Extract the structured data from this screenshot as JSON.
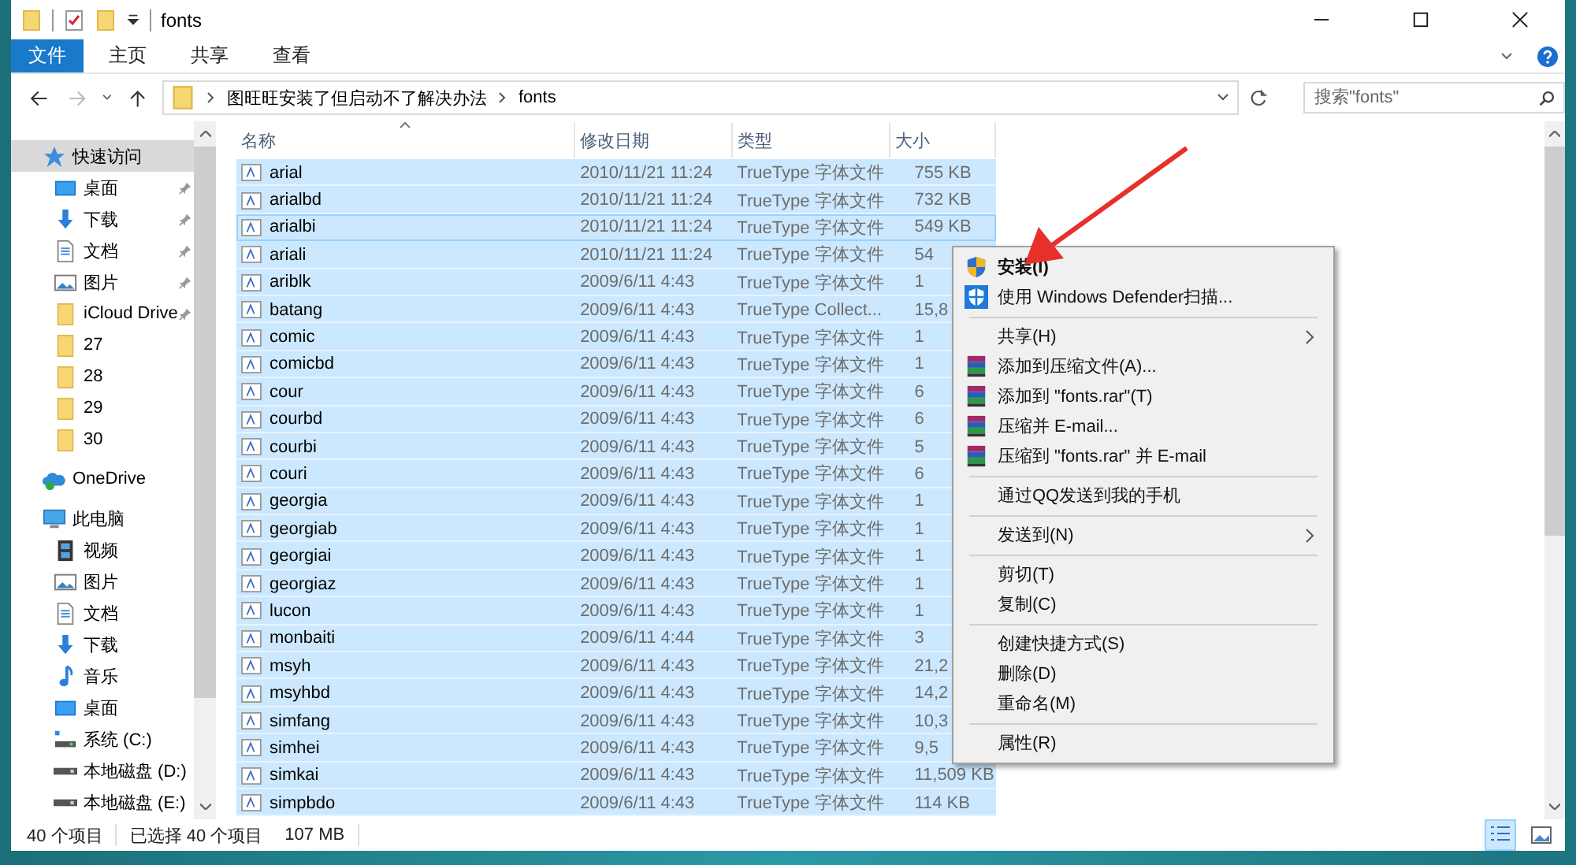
{
  "window": {
    "title": "fonts"
  },
  "ribbon": {
    "tabs": [
      {
        "label": "文件",
        "selected": true
      },
      {
        "label": "主页",
        "selected": false
      },
      {
        "label": "共享",
        "selected": false
      },
      {
        "label": "查看",
        "selected": false
      }
    ]
  },
  "address_bar": {
    "path": [
      "图旺旺安装了但启动不了解决办法",
      "fonts"
    ],
    "search": {
      "placeholder": "搜索\"fonts\""
    }
  },
  "sidebar": {
    "items": [
      {
        "label": "快速访问",
        "kind": "star",
        "selected": true,
        "children": [
          {
            "label": "桌面",
            "kind": "desktop",
            "pinned": true,
            "selected": false
          },
          {
            "label": "下载",
            "kind": "download",
            "pinned": true,
            "selected": false
          },
          {
            "label": "文档",
            "kind": "document",
            "pinned": true,
            "selected": false
          },
          {
            "label": "图片",
            "kind": "picture",
            "pinned": true,
            "selected": false
          },
          {
            "label": "iCloud Drive",
            "kind": "folder",
            "pinned": true,
            "selected": false
          },
          {
            "label": "27",
            "kind": "folder",
            "pinned": false,
            "selected": false
          },
          {
            "label": "28",
            "kind": "folder",
            "pinned": false,
            "selected": false
          },
          {
            "label": "29",
            "kind": "folder",
            "pinned": false,
            "selected": false
          },
          {
            "label": "30",
            "kind": "folder",
            "pinned": false,
            "selected": false
          }
        ]
      },
      {
        "label": "OneDrive",
        "kind": "cloud",
        "selected": false
      },
      {
        "label": "此电脑",
        "kind": "computer",
        "selected": false,
        "children": [
          {
            "label": "视频",
            "kind": "video",
            "pinned": false,
            "selected": false
          },
          {
            "label": "图片",
            "kind": "picture",
            "pinned": false,
            "selected": false
          },
          {
            "label": "文档",
            "kind": "document",
            "pinned": false,
            "selected": false
          },
          {
            "label": "下载",
            "kind": "download",
            "pinned": false,
            "selected": false
          },
          {
            "label": "音乐",
            "kind": "music",
            "pinned": false,
            "selected": false
          },
          {
            "label": "桌面",
            "kind": "desktop",
            "pinned": false,
            "selected": false
          },
          {
            "label": "系统 (C:)",
            "kind": "system-drive",
            "pinned": false,
            "selected": false
          },
          {
            "label": "本地磁盘 (D:)",
            "kind": "drive",
            "pinned": false,
            "selected": false
          },
          {
            "label": "本地磁盘 (E:)",
            "kind": "drive",
            "pinned": false,
            "selected": false
          }
        ]
      }
    ]
  },
  "table": {
    "columns": [
      "名称",
      "修改日期",
      "类型",
      "大小"
    ],
    "rows": [
      {
        "name": "arial",
        "date": "2010/11/21 11:24",
        "type": "TrueType 字体文件",
        "size": "755 KB",
        "selected": true,
        "focused": false
      },
      {
        "name": "arialbd",
        "date": "2010/11/21 11:24",
        "type": "TrueType 字体文件",
        "size": "732 KB",
        "selected": true,
        "focused": false
      },
      {
        "name": "arialbi",
        "date": "2010/11/21 11:24",
        "type": "TrueType 字体文件",
        "size": "549 KB",
        "selected": true,
        "focused": true
      },
      {
        "name": "ariali",
        "date": "2010/11/21 11:24",
        "type": "TrueType 字体文件",
        "size": "54",
        "selected": true,
        "focused": false
      },
      {
        "name": "ariblk",
        "date": "2009/6/11 4:43",
        "type": "TrueType 字体文件",
        "size": "1",
        "selected": true,
        "focused": false
      },
      {
        "name": "batang",
        "date": "2009/6/11 4:43",
        "type": "TrueType Collect...",
        "size": "15,8",
        "selected": true,
        "focused": false
      },
      {
        "name": "comic",
        "date": "2009/6/11 4:43",
        "type": "TrueType 字体文件",
        "size": "1",
        "selected": true,
        "focused": false
      },
      {
        "name": "comicbd",
        "date": "2009/6/11 4:43",
        "type": "TrueType 字体文件",
        "size": "1",
        "selected": true,
        "focused": false
      },
      {
        "name": "cour",
        "date": "2009/6/11 4:43",
        "type": "TrueType 字体文件",
        "size": "6",
        "selected": true,
        "focused": false
      },
      {
        "name": "courbd",
        "date": "2009/6/11 4:43",
        "type": "TrueType 字体文件",
        "size": "6",
        "selected": true,
        "focused": false
      },
      {
        "name": "courbi",
        "date": "2009/6/11 4:43",
        "type": "TrueType 字体文件",
        "size": "5",
        "selected": true,
        "focused": false
      },
      {
        "name": "couri",
        "date": "2009/6/11 4:43",
        "type": "TrueType 字体文件",
        "size": "6",
        "selected": true,
        "focused": false
      },
      {
        "name": "georgia",
        "date": "2009/6/11 4:43",
        "type": "TrueType 字体文件",
        "size": "1",
        "selected": true,
        "focused": false
      },
      {
        "name": "georgiab",
        "date": "2009/6/11 4:43",
        "type": "TrueType 字体文件",
        "size": "1",
        "selected": true,
        "focused": false
      },
      {
        "name": "georgiai",
        "date": "2009/6/11 4:43",
        "type": "TrueType 字体文件",
        "size": "1",
        "selected": true,
        "focused": false
      },
      {
        "name": "georgiaz",
        "date": "2009/6/11 4:43",
        "type": "TrueType 字体文件",
        "size": "1",
        "selected": true,
        "focused": false
      },
      {
        "name": "lucon",
        "date": "2009/6/11 4:43",
        "type": "TrueType 字体文件",
        "size": "1",
        "selected": true,
        "focused": false
      },
      {
        "name": "monbaiti",
        "date": "2009/6/11 4:44",
        "type": "TrueType 字体文件",
        "size": "3",
        "selected": true,
        "focused": false
      },
      {
        "name": "msyh",
        "date": "2009/6/11 4:43",
        "type": "TrueType 字体文件",
        "size": "21,2",
        "selected": true,
        "focused": false
      },
      {
        "name": "msyhbd",
        "date": "2009/6/11 4:43",
        "type": "TrueType 字体文件",
        "size": "14,2",
        "selected": true,
        "focused": false
      },
      {
        "name": "simfang",
        "date": "2009/6/11 4:43",
        "type": "TrueType 字体文件",
        "size": "10,3",
        "selected": true,
        "focused": false
      },
      {
        "name": "simhei",
        "date": "2009/6/11 4:43",
        "type": "TrueType 字体文件",
        "size": "9,5",
        "selected": true,
        "focused": false
      },
      {
        "name": "simkai",
        "date": "2009/6/11 4:43",
        "type": "TrueType 字体文件",
        "size": "11,509 KB",
        "selected": true,
        "focused": false
      },
      {
        "name": "simpbdo",
        "date": "2009/6/11 4:43",
        "type": "TrueType 字体文件",
        "size": "114 KB",
        "selected": true,
        "focused": false
      }
    ]
  },
  "context_menu": {
    "groups": [
      [
        {
          "label": "安装(I)",
          "kind": "shield",
          "default": true,
          "submenu": false
        },
        {
          "label": "使用 Windows Defender扫描...",
          "kind": "defender",
          "default": false,
          "submenu": false
        }
      ],
      [
        {
          "label": "共享(H)",
          "kind": "none",
          "default": false,
          "submenu": true
        },
        {
          "label": "添加到压缩文件(A)...",
          "kind": "archive",
          "default": false,
          "submenu": false
        },
        {
          "label": "添加到 \"fonts.rar\"(T)",
          "kind": "archive",
          "default": false,
          "submenu": false
        },
        {
          "label": "压缩并 E-mail...",
          "kind": "archive",
          "default": false,
          "submenu": false
        },
        {
          "label": "压缩到 \"fonts.rar\" 并 E-mail",
          "kind": "archive",
          "default": false,
          "submenu": false
        }
      ],
      [
        {
          "label": "通过QQ发送到我的手机",
          "kind": "none",
          "default": false,
          "submenu": false
        }
      ],
      [
        {
          "label": "发送到(N)",
          "kind": "none",
          "default": false,
          "submenu": true
        }
      ],
      [
        {
          "label": "剪切(T)",
          "kind": "none",
          "default": false,
          "submenu": false
        },
        {
          "label": "复制(C)",
          "kind": "none",
          "default": false,
          "submenu": false
        }
      ],
      [
        {
          "label": "创建快捷方式(S)",
          "kind": "none",
          "default": false,
          "submenu": false
        },
        {
          "label": "删除(D)",
          "kind": "none",
          "default": false,
          "submenu": false
        },
        {
          "label": "重命名(M)",
          "kind": "none",
          "default": false,
          "submenu": false
        }
      ],
      [
        {
          "label": "属性(R)",
          "kind": "none",
          "default": false,
          "submenu": false
        }
      ]
    ]
  },
  "status_bar": {
    "count": "40 个项目",
    "selection": "已选择 40 个项目",
    "size": "107 MB"
  }
}
